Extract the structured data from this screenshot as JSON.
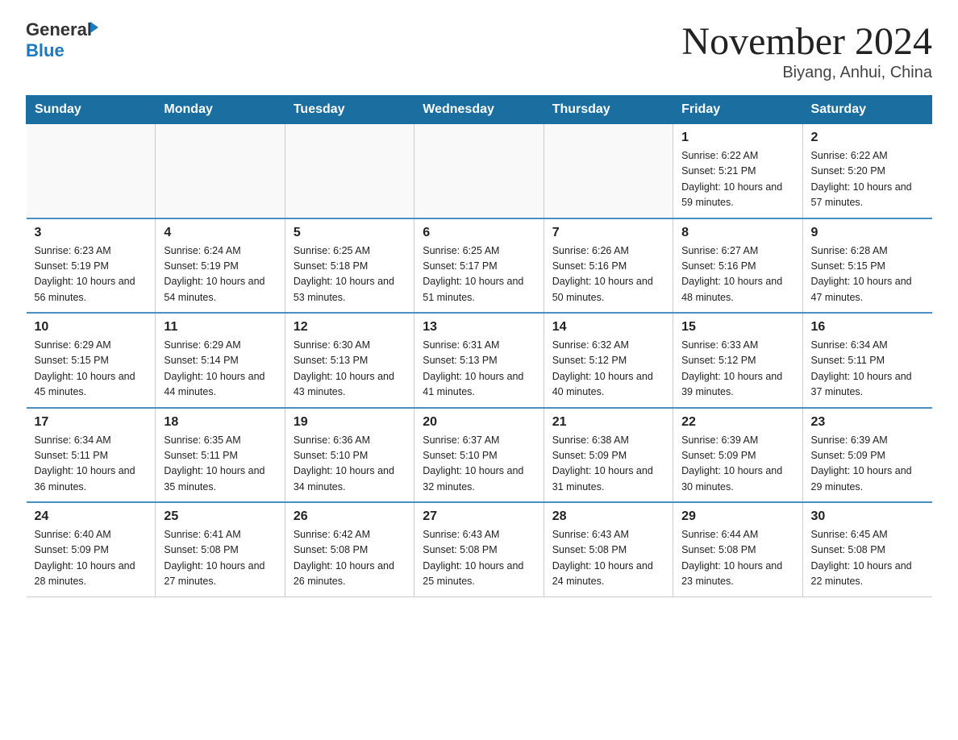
{
  "header": {
    "logo_general": "General",
    "logo_blue": "Blue",
    "month_title": "November 2024",
    "location": "Biyang, Anhui, China"
  },
  "weekdays": [
    "Sunday",
    "Monday",
    "Tuesday",
    "Wednesday",
    "Thursday",
    "Friday",
    "Saturday"
  ],
  "weeks": [
    [
      {
        "day": "",
        "info": ""
      },
      {
        "day": "",
        "info": ""
      },
      {
        "day": "",
        "info": ""
      },
      {
        "day": "",
        "info": ""
      },
      {
        "day": "",
        "info": ""
      },
      {
        "day": "1",
        "info": "Sunrise: 6:22 AM\nSunset: 5:21 PM\nDaylight: 10 hours and 59 minutes."
      },
      {
        "day": "2",
        "info": "Sunrise: 6:22 AM\nSunset: 5:20 PM\nDaylight: 10 hours and 57 minutes."
      }
    ],
    [
      {
        "day": "3",
        "info": "Sunrise: 6:23 AM\nSunset: 5:19 PM\nDaylight: 10 hours and 56 minutes."
      },
      {
        "day": "4",
        "info": "Sunrise: 6:24 AM\nSunset: 5:19 PM\nDaylight: 10 hours and 54 minutes."
      },
      {
        "day": "5",
        "info": "Sunrise: 6:25 AM\nSunset: 5:18 PM\nDaylight: 10 hours and 53 minutes."
      },
      {
        "day": "6",
        "info": "Sunrise: 6:25 AM\nSunset: 5:17 PM\nDaylight: 10 hours and 51 minutes."
      },
      {
        "day": "7",
        "info": "Sunrise: 6:26 AM\nSunset: 5:16 PM\nDaylight: 10 hours and 50 minutes."
      },
      {
        "day": "8",
        "info": "Sunrise: 6:27 AM\nSunset: 5:16 PM\nDaylight: 10 hours and 48 minutes."
      },
      {
        "day": "9",
        "info": "Sunrise: 6:28 AM\nSunset: 5:15 PM\nDaylight: 10 hours and 47 minutes."
      }
    ],
    [
      {
        "day": "10",
        "info": "Sunrise: 6:29 AM\nSunset: 5:15 PM\nDaylight: 10 hours and 45 minutes."
      },
      {
        "day": "11",
        "info": "Sunrise: 6:29 AM\nSunset: 5:14 PM\nDaylight: 10 hours and 44 minutes."
      },
      {
        "day": "12",
        "info": "Sunrise: 6:30 AM\nSunset: 5:13 PM\nDaylight: 10 hours and 43 minutes."
      },
      {
        "day": "13",
        "info": "Sunrise: 6:31 AM\nSunset: 5:13 PM\nDaylight: 10 hours and 41 minutes."
      },
      {
        "day": "14",
        "info": "Sunrise: 6:32 AM\nSunset: 5:12 PM\nDaylight: 10 hours and 40 minutes."
      },
      {
        "day": "15",
        "info": "Sunrise: 6:33 AM\nSunset: 5:12 PM\nDaylight: 10 hours and 39 minutes."
      },
      {
        "day": "16",
        "info": "Sunrise: 6:34 AM\nSunset: 5:11 PM\nDaylight: 10 hours and 37 minutes."
      }
    ],
    [
      {
        "day": "17",
        "info": "Sunrise: 6:34 AM\nSunset: 5:11 PM\nDaylight: 10 hours and 36 minutes."
      },
      {
        "day": "18",
        "info": "Sunrise: 6:35 AM\nSunset: 5:11 PM\nDaylight: 10 hours and 35 minutes."
      },
      {
        "day": "19",
        "info": "Sunrise: 6:36 AM\nSunset: 5:10 PM\nDaylight: 10 hours and 34 minutes."
      },
      {
        "day": "20",
        "info": "Sunrise: 6:37 AM\nSunset: 5:10 PM\nDaylight: 10 hours and 32 minutes."
      },
      {
        "day": "21",
        "info": "Sunrise: 6:38 AM\nSunset: 5:09 PM\nDaylight: 10 hours and 31 minutes."
      },
      {
        "day": "22",
        "info": "Sunrise: 6:39 AM\nSunset: 5:09 PM\nDaylight: 10 hours and 30 minutes."
      },
      {
        "day": "23",
        "info": "Sunrise: 6:39 AM\nSunset: 5:09 PM\nDaylight: 10 hours and 29 minutes."
      }
    ],
    [
      {
        "day": "24",
        "info": "Sunrise: 6:40 AM\nSunset: 5:09 PM\nDaylight: 10 hours and 28 minutes."
      },
      {
        "day": "25",
        "info": "Sunrise: 6:41 AM\nSunset: 5:08 PM\nDaylight: 10 hours and 27 minutes."
      },
      {
        "day": "26",
        "info": "Sunrise: 6:42 AM\nSunset: 5:08 PM\nDaylight: 10 hours and 26 minutes."
      },
      {
        "day": "27",
        "info": "Sunrise: 6:43 AM\nSunset: 5:08 PM\nDaylight: 10 hours and 25 minutes."
      },
      {
        "day": "28",
        "info": "Sunrise: 6:43 AM\nSunset: 5:08 PM\nDaylight: 10 hours and 24 minutes."
      },
      {
        "day": "29",
        "info": "Sunrise: 6:44 AM\nSunset: 5:08 PM\nDaylight: 10 hours and 23 minutes."
      },
      {
        "day": "30",
        "info": "Sunrise: 6:45 AM\nSunset: 5:08 PM\nDaylight: 10 hours and 22 minutes."
      }
    ]
  ]
}
